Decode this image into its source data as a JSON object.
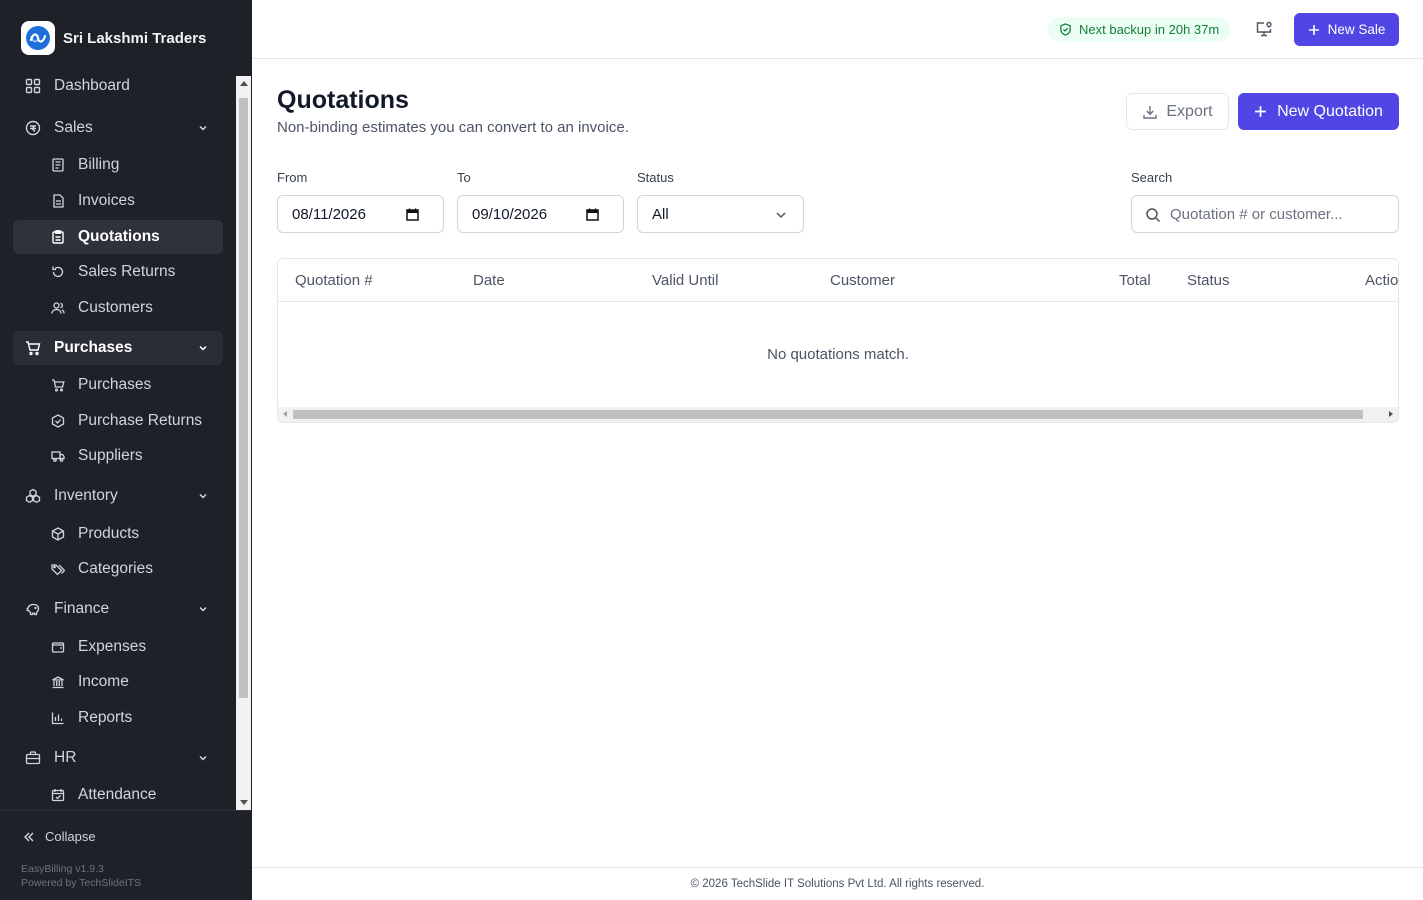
{
  "brand": {
    "name": "Sri Lakshmi Traders"
  },
  "sidebar": {
    "items": [
      {
        "label": "Dashboard",
        "icon": "dashboard-icon"
      },
      {
        "label": "Sales",
        "icon": "sales-icon"
      },
      {
        "label": "Billing",
        "icon": "billing-icon"
      },
      {
        "label": "Invoices",
        "icon": "invoice-icon"
      },
      {
        "label": "Quotations",
        "icon": "quotation-icon"
      },
      {
        "label": "Sales Returns",
        "icon": "return-icon"
      },
      {
        "label": "Customers",
        "icon": "customers-icon"
      },
      {
        "label": "Purchases",
        "icon": "cart-icon"
      },
      {
        "label": "Purchases",
        "icon": "cart-icon"
      },
      {
        "label": "Purchase Returns",
        "icon": "purchase-return-icon"
      },
      {
        "label": "Suppliers",
        "icon": "truck-icon"
      },
      {
        "label": "Inventory",
        "icon": "boxes-icon"
      },
      {
        "label": "Products",
        "icon": "package-icon"
      },
      {
        "label": "Categories",
        "icon": "tags-icon"
      },
      {
        "label": "Finance",
        "icon": "piggy-bank-icon"
      },
      {
        "label": "Expenses",
        "icon": "wallet-icon"
      },
      {
        "label": "Income",
        "icon": "bank-icon"
      },
      {
        "label": "Reports",
        "icon": "bar-chart-icon"
      },
      {
        "label": "HR",
        "icon": "briefcase-icon"
      },
      {
        "label": "Attendance",
        "icon": "calendar-check-icon"
      }
    ],
    "collapse_label": "Collapse",
    "version": "EasyBilling v1.9.3",
    "powered_by": "Powered by TechSlideITS"
  },
  "topbar": {
    "backup_status": "Next backup in 20h 37m",
    "new_sale_label": "New Sale"
  },
  "page": {
    "title": "Quotations",
    "subtitle": "Non-binding estimates you can convert to an invoice.",
    "export_label": "Export",
    "new_quotation_label": "New Quotation"
  },
  "filters": {
    "from_label": "From",
    "from_value": "08/11/2026",
    "to_label": "To",
    "to_value": "09/10/2026",
    "status_label": "Status",
    "status_value": "All",
    "search_label": "Search",
    "search_placeholder": "Quotation # or customer..."
  },
  "table": {
    "columns": [
      "Quotation #",
      "Date",
      "Valid Until",
      "Customer",
      "Total",
      "Status",
      "Actio"
    ],
    "empty_message": "No quotations match."
  },
  "footer": {
    "text": "© 2026 TechSlide IT Solutions Pvt Ltd. All rights reserved."
  },
  "colors": {
    "accent": "#4f46e5",
    "sidebar_bg": "#1f2128",
    "backup_green": "#15803d"
  }
}
